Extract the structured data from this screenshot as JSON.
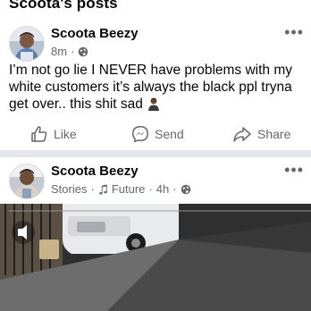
{
  "section": {
    "title": "Scoota's posts"
  },
  "post1": {
    "author": "Scoota Beezy",
    "time": "8m",
    "separator": "·",
    "text": "I’m not go lie I NEVER have problems with my white customers it’s always the black ppl tryna get over.. this shit sad",
    "more_label": "•••"
  },
  "actions": {
    "like": "Like",
    "send": "Send",
    "share": "Share"
  },
  "post2": {
    "author": "Scoota Beezy",
    "source": "Stories",
    "separator": "·",
    "music": "Future",
    "time": "4h",
    "more_label": "•••"
  },
  "icons": {
    "globe": "globe-icon",
    "like": "thumbs-up-icon",
    "send": "messenger-icon",
    "share": "share-arrow-icon",
    "music": "music-note-icon",
    "more": "more-dots-icon"
  },
  "colors": {
    "text_primary": "#050505",
    "text_secondary": "#65676b",
    "divider": "#e4e6eb"
  }
}
